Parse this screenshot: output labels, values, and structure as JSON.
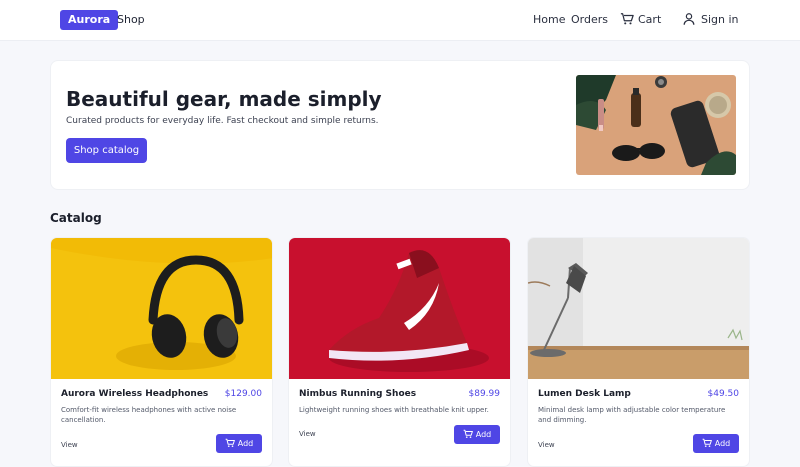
{
  "nav": {
    "brand": "Aurora",
    "shop": "Shop",
    "home": "Home",
    "orders": "Orders",
    "cart": "Cart",
    "sign_in": "Sign in",
    "cart_icon": "cart-icon",
    "user_icon": "user-icon"
  },
  "hero": {
    "title": "Beautiful gear, made simply",
    "subtitle": "Curated products for everyday life. Fast checkout and simple returns.",
    "cta": "Shop catalog"
  },
  "catalog": {
    "title": "Catalog",
    "products": [
      {
        "name": "Aurora Wireless Headphones",
        "price": "$129.00",
        "description": "Comfort-fit wireless headphones with active noise cancellation.",
        "view": "View",
        "add": "Add"
      },
      {
        "name": "Nimbus Running Shoes",
        "price": "$89.99",
        "description": "Lightweight running shoes with breathable knit upper.",
        "view": "View",
        "add": "Add"
      },
      {
        "name": "Lumen Desk Lamp",
        "price": "$49.50",
        "description": "Minimal desk lamp with adjustable color temperature and dimming.",
        "view": "View",
        "add": "Add"
      }
    ]
  },
  "colors": {
    "accent": "#4f46e5",
    "background": "#f6f7fb"
  }
}
